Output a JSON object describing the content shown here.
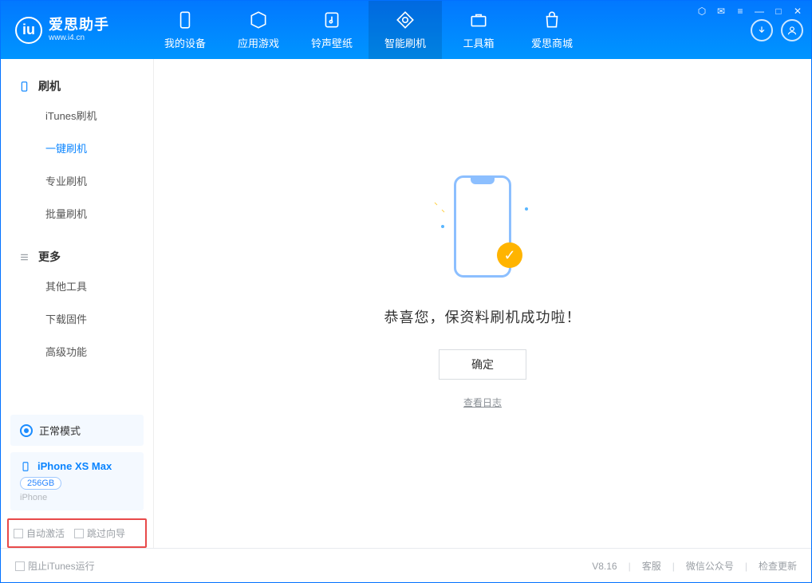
{
  "app": {
    "name_cn": "爱思助手",
    "name_en": "www.i4.cn"
  },
  "tabs": {
    "device": "我的设备",
    "apps": "应用游戏",
    "ringtones": "铃声壁纸",
    "flash": "智能刷机",
    "toolbox": "工具箱",
    "store": "爱思商城"
  },
  "sidebar": {
    "group_flash": "刷机",
    "items_flash": {
      "itunes": "iTunes刷机",
      "onekey": "一键刷机",
      "pro": "专业刷机",
      "batch": "批量刷机"
    },
    "group_more": "更多",
    "items_more": {
      "other": "其他工具",
      "download": "下载固件",
      "advanced": "高级功能"
    }
  },
  "device": {
    "mode": "正常模式",
    "name": "iPhone XS Max",
    "storage": "256GB",
    "type": "iPhone"
  },
  "options": {
    "auto_activate": "自动激活",
    "skip_guide": "跳过向导"
  },
  "main": {
    "success": "恭喜您，保资料刷机成功啦！",
    "ok": "确定",
    "view_log": "查看日志"
  },
  "footer": {
    "block_itunes": "阻止iTunes运行",
    "version": "V8.16",
    "support": "客服",
    "wechat": "微信公众号",
    "update": "检查更新"
  }
}
